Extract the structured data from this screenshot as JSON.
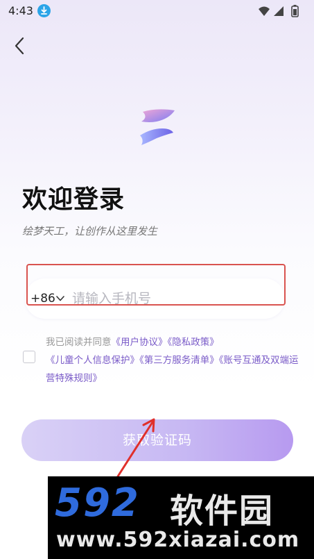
{
  "status_bar": {
    "time": "4:43"
  },
  "header": {
    "back_label": "返回"
  },
  "login": {
    "title": "欢迎登录",
    "subtitle": "绘梦天工，让创作从这里发生",
    "country_code": "+86",
    "phone_placeholder": "请输入手机号",
    "agreement": {
      "prefix": "我已阅读并同意",
      "user_agreement": "《用户协议》",
      "privacy_policy": "《隐私政策》",
      "child_protection": "《儿童个人信息保护》",
      "third_party_list": "《第三方服务清单》",
      "account_rules": "《账号互通及双端运营特殊规则》"
    },
    "submit_label": "获取验证码"
  },
  "watermark": {
    "brand_number": "592",
    "brand_name": "软件园",
    "url": "www.592xiazai.com"
  },
  "colors": {
    "accent": "#7a5bc8",
    "button_gradient_start": "#d9d1f6",
    "button_gradient_end": "#b79af0",
    "highlight": "#d9534f"
  }
}
